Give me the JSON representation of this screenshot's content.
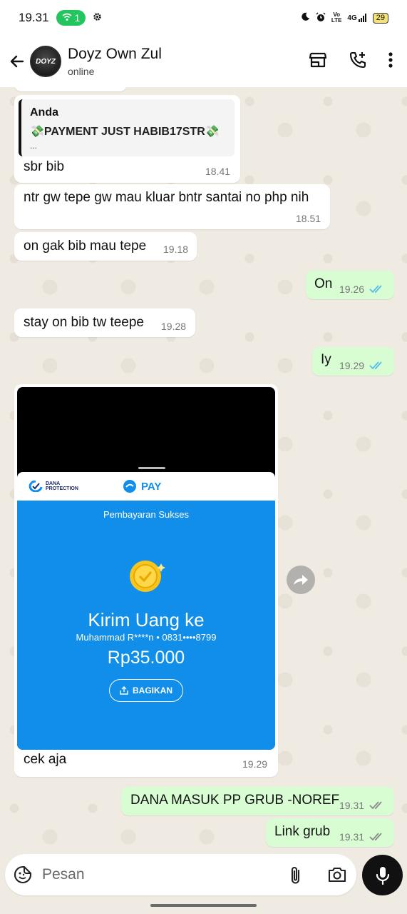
{
  "status_bar": {
    "time": "19.31",
    "hotspot_count": "1",
    "volte_top": "Vo",
    "volte_bottom": "LTE",
    "signal": "4G",
    "battery": "29"
  },
  "header": {
    "contact_name": "Doyz Own Zul",
    "status": "online",
    "avatar_text": "DOYZ"
  },
  "messages": {
    "m1": {
      "quote_name": "Anda",
      "quote_text": "💸PAYMENT JUST HABIB17STR💸",
      "quote_more": "...",
      "text": "sbr bib",
      "time": "18.41"
    },
    "m2": {
      "text": "ntr gw tepe gw mau kluar bntr santai no php nih",
      "time": "18.51"
    },
    "m3": {
      "text": "on gak bib mau tepe",
      "time": "19.18"
    },
    "m4": {
      "text": "On",
      "time": "19.26"
    },
    "m5": {
      "text": "stay on bib tw teepe",
      "time": "19.28"
    },
    "m6": {
      "text": "Iy",
      "time": "19.29"
    },
    "m7": {
      "caption": "cek aja",
      "time": "19.29",
      "receipt": {
        "protection_line1": "DANA",
        "protection_line2": "PROTECTION",
        "pay_label": "PAY",
        "status": "Pembayaran Sukses",
        "title": "Kirim Uang ke",
        "recipient": "Muhammad R****n • 0831••••8799",
        "amount": "Rp35.000",
        "share_label": "BAGIKAN"
      }
    },
    "m8": {
      "text": "DANA MASUK PP GRUB -NOREF",
      "time": "19.31"
    },
    "m9": {
      "text": "Link grub",
      "time": "19.31"
    }
  },
  "input": {
    "placeholder": "Pesan"
  },
  "colors": {
    "incoming_bubble": "#ffffff",
    "outgoing_bubble": "#d9fdd3",
    "chat_bg": "#efeae2",
    "read_ticks": "#53bdeb",
    "delivered_ticks": "#8a8a8a",
    "dana_blue": "#108ee9"
  }
}
